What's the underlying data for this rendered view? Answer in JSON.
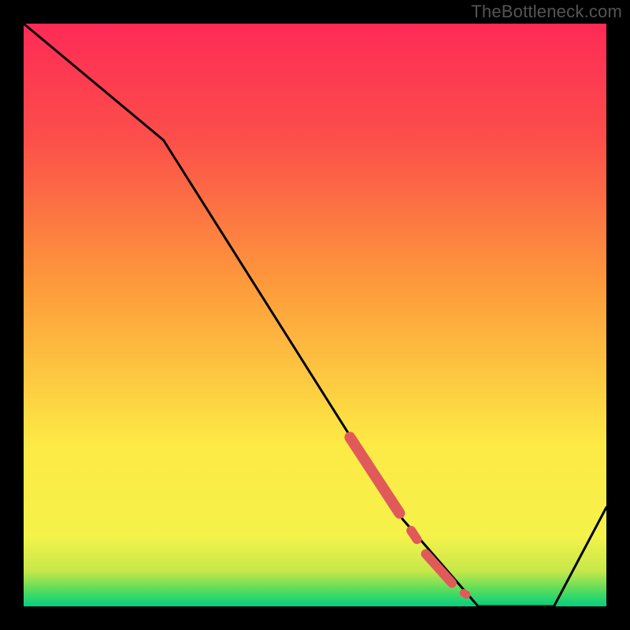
{
  "watermark": "TheBottleneck.com",
  "chart_data": {
    "type": "line",
    "title": "",
    "xlabel": "",
    "ylabel": "",
    "xlim": [
      0,
      100
    ],
    "ylim": [
      0,
      100
    ],
    "grid": false,
    "legend": false,
    "note": "Y is inverted compared to usual: lower = better (green). Background gradient encodes color scale. Black curve with red highlight segments.",
    "background_gradient": {
      "stops": [
        {
          "y": 0,
          "color": "#00d082"
        },
        {
          "y": 3,
          "color": "#5fdc5a"
        },
        {
          "y": 6,
          "color": "#c5e84a"
        },
        {
          "y": 12,
          "color": "#f5f24a"
        },
        {
          "y": 28,
          "color": "#fde945"
        },
        {
          "y": 55,
          "color": "#fd9b3b"
        },
        {
          "y": 80,
          "color": "#fc4f4a"
        },
        {
          "y": 100,
          "color": "#fe2a56"
        }
      ]
    },
    "curve_black": {
      "x": [
        0,
        6,
        24,
        65,
        78,
        82,
        91,
        100
      ],
      "y": [
        100,
        95,
        80,
        15,
        0,
        0,
        0,
        17
      ]
    },
    "highlight_segments": [
      {
        "style": "thick",
        "x": [
          56,
          64.5
        ],
        "y": [
          29,
          16
        ]
      },
      {
        "style": "mid",
        "x": [
          66.5,
          67.5
        ],
        "y": [
          13,
          11.5
        ]
      },
      {
        "style": "mid",
        "x": [
          69,
          73.5
        ],
        "y": [
          9,
          4
        ]
      },
      {
        "style": "dot",
        "x": [
          75.5,
          76
        ],
        "y": [
          2.3,
          2.0
        ]
      }
    ],
    "colors": {
      "curve": "#000000",
      "highlight": "#e05a5a",
      "frame": "#000000"
    }
  }
}
